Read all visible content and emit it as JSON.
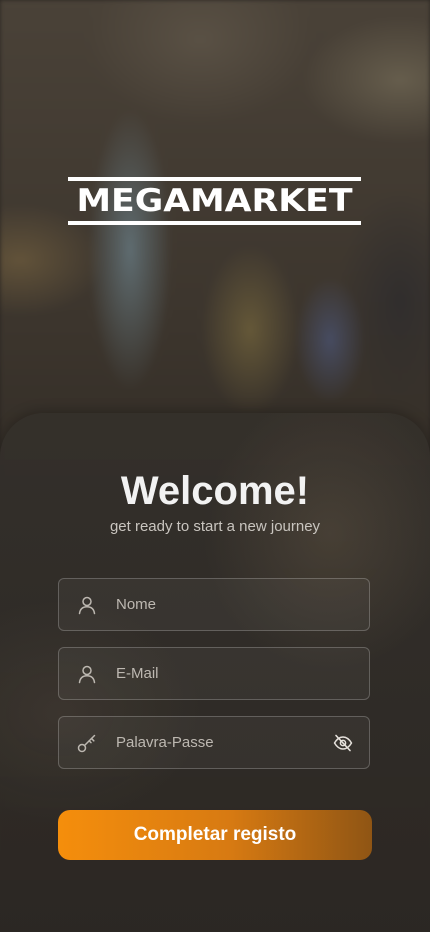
{
  "brand": {
    "logo_text": "MEGAMARKET"
  },
  "welcome": {
    "title": "Welcome!",
    "subtitle": "get ready to start a new journey"
  },
  "form": {
    "name_placeholder": "Nome",
    "email_placeholder": "E-Mail",
    "password_placeholder": "Palavra-Passe",
    "submit_label": "Completar registo"
  },
  "icons": {
    "name_field": "user-icon",
    "email_field": "user-icon",
    "password_field": "key-icon",
    "password_toggle": "eye-off-icon"
  },
  "colors": {
    "accent_start": "#f58e0c",
    "accent_end": "#8f5514",
    "text_primary": "#f2f2f2",
    "text_muted": "#bdb8b1"
  }
}
